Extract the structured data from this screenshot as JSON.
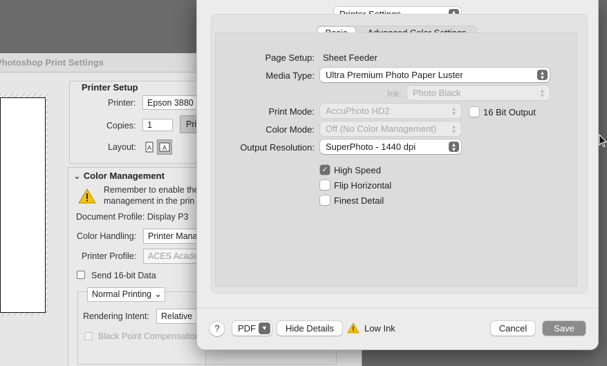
{
  "photoshop": {
    "window_title": "Photoshop Print Settings",
    "printer_setup": {
      "heading": "Printer Setup",
      "printer_label": "Printer:",
      "printer_value": "Epson 3880",
      "copies_label": "Copies:",
      "copies_value": "1",
      "print_settings_button": "Pri",
      "layout_label": "Layout:"
    },
    "color_management": {
      "heading": "Color Management",
      "warning_line1": "Remember to enable the",
      "warning_line2": "management in the prin",
      "document_profile": "Document Profile: Display P3",
      "color_handling_label": "Color Handling:",
      "color_handling_value": "Printer Mana",
      "printer_profile_label": "Printer Profile:",
      "printer_profile_value": "ACES Acade",
      "send_16bit_label": "Send 16-bit Data",
      "normal_printing": "Normal Printing",
      "rendering_intent_label": "Rendering Intent:",
      "rendering_intent_value": "Relative",
      "black_point_label": "Black Point Compensation"
    }
  },
  "dialog": {
    "preset_popup": "Printer Settings",
    "tabs": [
      {
        "label": "Basic",
        "selected": true
      },
      {
        "label": "Advanced Color Settings",
        "selected": false
      }
    ],
    "page_setup_label": "Page Setup:",
    "page_setup_value": "Sheet Feeder",
    "media_type_label": "Media Type:",
    "media_type_value": "Ultra Premium Photo Paper Luster",
    "ink_label": "Ink:",
    "ink_value": "Photo Black",
    "print_mode_label": "Print Mode:",
    "print_mode_value": "AccuPhoto HD2",
    "bit16_label": "16 Bit Output",
    "color_mode_label": "Color Mode:",
    "color_mode_value": "Off (No Color Management)",
    "output_resolution_label": "Output Resolution:",
    "output_resolution_value": "SuperPhoto - 1440 dpi",
    "checkboxes": [
      {
        "label": "High Speed",
        "checked": true
      },
      {
        "label": "Flip Horizontal",
        "checked": false
      },
      {
        "label": "Finest Detail",
        "checked": false
      }
    ],
    "footer": {
      "help": "?",
      "pdf": "PDF",
      "hide_details": "Hide Details",
      "low_ink": "Low Ink",
      "cancel": "Cancel",
      "save": "Save"
    }
  }
}
